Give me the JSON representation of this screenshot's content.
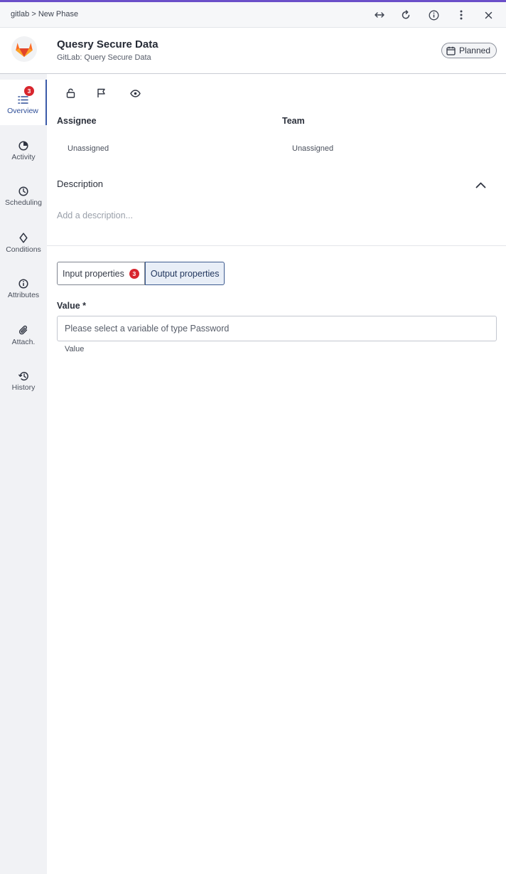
{
  "topbar": {
    "breadcrumb": "gitlab > New Phase",
    "icons": [
      "expand-horizontal-icon",
      "refresh-icon",
      "info-icon",
      "more-vertical-icon",
      "close-icon"
    ]
  },
  "header": {
    "title": "Quesry Secure Data",
    "subtitle": "GitLab: Query Secure Data",
    "status_label": "Planned"
  },
  "sidebar": {
    "items": [
      {
        "label": "Overview",
        "badge": "3",
        "icon": "list-icon"
      },
      {
        "label": "Activity",
        "icon": "pie-icon"
      },
      {
        "label": "Scheduling",
        "icon": "clock-icon"
      },
      {
        "label": "Conditions",
        "icon": "diamond-icon"
      },
      {
        "label": "Attributes",
        "icon": "info-icon"
      },
      {
        "label": "Attach.",
        "icon": "paperclip-icon"
      },
      {
        "label": "History",
        "icon": "history-icon"
      }
    ]
  },
  "main": {
    "actions": [
      "lock-open-icon",
      "flag-icon",
      "eye-icon"
    ],
    "assignee_label": "Assignee",
    "assignee_value": "Unassigned",
    "team_label": "Team",
    "team_value": "Unassigned",
    "description_label": "Description",
    "description_placeholder": "Add a description...",
    "tabs": [
      {
        "label": "Input properties",
        "badge": "3"
      },
      {
        "label": "Output properties"
      }
    ],
    "value_label": "Value *",
    "value_placeholder": "Please select a variable of type Password",
    "value_helper": "Value"
  },
  "colors": {
    "accent": "#6b4fc9",
    "active_nav": "#3a5aa8",
    "badge": "#d8262e",
    "gitlab_orange": "#e24329"
  }
}
